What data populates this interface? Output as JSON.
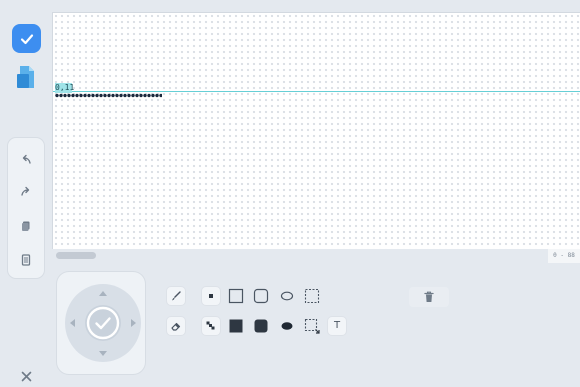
{
  "toolbar": {
    "confirm": {
      "icon": "check-icon",
      "color": "#3d8ef0"
    },
    "file": {
      "icon": "file-icon",
      "color": "#2f8bd6"
    },
    "history": [
      {
        "icon": "undo-icon"
      },
      {
        "icon": "redo-icon"
      },
      {
        "icon": "copy-icon"
      },
      {
        "icon": "document-icon"
      }
    ],
    "close": {
      "icon": "close-icon"
    }
  },
  "canvas": {
    "cursor_label": "0,11",
    "range": "0 - 88",
    "accent": "#66cfd6"
  },
  "tools": {
    "row1": [
      "brush-icon",
      "filled-square-small-icon",
      "rect-outline-icon",
      "rounded-rect-outline-icon",
      "ellipse-outline-icon",
      "dashed-selection-icon"
    ],
    "row2": [
      "eraser-icon",
      "line-icon",
      "filled-rect-icon",
      "filled-rounded-rect-icon",
      "filled-ellipse-icon",
      "selection-move-icon",
      "text-icon"
    ],
    "text_tool_label": "T",
    "delete": "trash-icon"
  }
}
